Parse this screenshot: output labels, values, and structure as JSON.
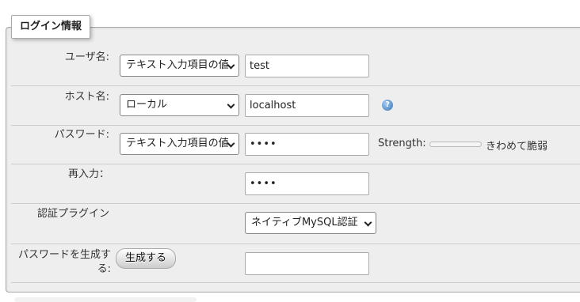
{
  "legend": "ログイン情報",
  "rows": {
    "username": {
      "label": "ユーザ名:",
      "select_value": "テキスト入力項目の値",
      "input_value": "test"
    },
    "host": {
      "label": "ホスト名:",
      "select_value": "ローカル",
      "input_value": "localhost",
      "help_glyph": "?"
    },
    "password": {
      "label": "パスワード:",
      "select_value": "テキスト入力項目の値",
      "input_value": "••••",
      "strength_label": "Strength:",
      "strength_level": 0,
      "strength_text": "きわめて脆弱"
    },
    "reenter": {
      "label": "再入力：",
      "input_value": "••••"
    },
    "auth_plugin": {
      "label": "認証プラグイン",
      "select_value": "ネイティブMySQL認証"
    },
    "generate": {
      "label_line1": "パスワードを生成す",
      "label_line2": "る:",
      "button_label": "生成する",
      "input_value": ""
    }
  },
  "colors": {
    "panel_bg": "#eeeeee",
    "help_icon": "#3a78b8"
  }
}
